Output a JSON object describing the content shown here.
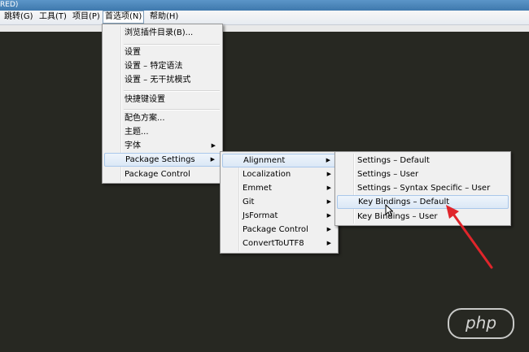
{
  "window": {
    "title_fragment": "RED)"
  },
  "menubar": {
    "items": [
      {
        "label": "跳转(G)"
      },
      {
        "label": "工具(T)"
      },
      {
        "label": "项目(P)"
      },
      {
        "label": "首选项(N)"
      },
      {
        "label": "帮助(H)"
      }
    ]
  },
  "preferences_menu": {
    "items": [
      {
        "label": "浏览插件目录(B)..."
      },
      {
        "label": "设置"
      },
      {
        "label": "设置 – 特定语法"
      },
      {
        "label": "设置 – 无干扰模式"
      },
      {
        "label": "快捷键设置"
      },
      {
        "label": "配色方案..."
      },
      {
        "label": "主题..."
      },
      {
        "label": "字体"
      },
      {
        "label": "Package Settings"
      },
      {
        "label": "Package Control"
      }
    ]
  },
  "package_settings_menu": {
    "items": [
      {
        "label": "Alignment"
      },
      {
        "label": "Localization"
      },
      {
        "label": "Emmet"
      },
      {
        "label": "Git"
      },
      {
        "label": "JsFormat"
      },
      {
        "label": "Package Control"
      },
      {
        "label": "ConvertToUTF8"
      }
    ]
  },
  "alignment_menu": {
    "items": [
      {
        "label": "Settings – Default"
      },
      {
        "label": "Settings – User"
      },
      {
        "label": "Settings – Syntax Specific – User"
      },
      {
        "label": "Key Bindings – Default"
      },
      {
        "label": "Key Bindings – User"
      }
    ]
  },
  "watermark": {
    "text": "php"
  },
  "colors": {
    "editor_bg": "#272822",
    "annotation_arrow": "#e0252b",
    "highlight_border": "#a9c7ea"
  },
  "icons": {
    "submenu": "triangle-right",
    "cursor": "arrow-pointer",
    "annotation": "red-arrow"
  }
}
